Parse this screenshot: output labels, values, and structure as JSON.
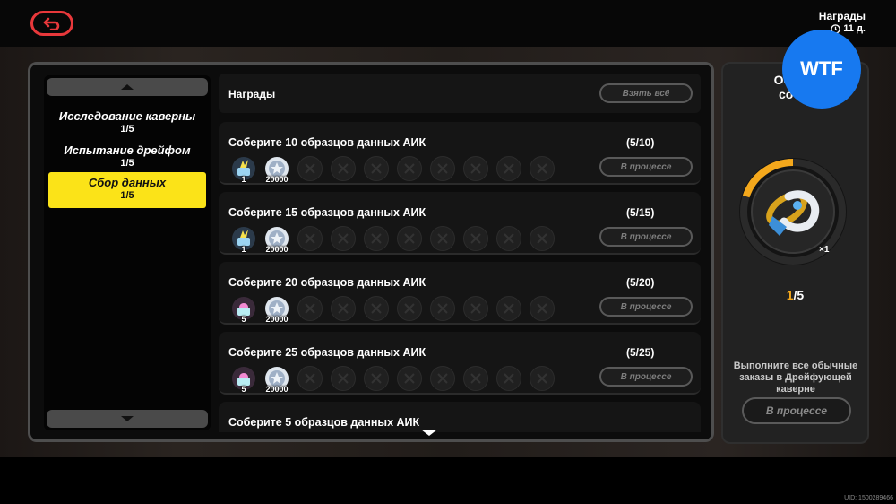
{
  "header": {
    "title": "Награды",
    "timer": "11 д."
  },
  "sidebar": {
    "items": [
      {
        "label": "Исследование каверны",
        "progress": "1/5",
        "active": false
      },
      {
        "label": "Испытание дрейфом",
        "progress": "1/5",
        "active": false
      },
      {
        "label": "Сбор данных",
        "progress": "1/5",
        "active": true
      }
    ]
  },
  "list": {
    "title": "Награды",
    "claim_all": "Взять всё",
    "quests": [
      {
        "title": "Соберите 10 образцов данных АИК",
        "progress": "(5/10)",
        "status": "В процессе",
        "rewards": [
          {
            "icon": "blue-drift-token-icon",
            "count": "1"
          },
          {
            "icon": "data-chip-icon",
            "count": "20000"
          }
        ]
      },
      {
        "title": "Соберите 15 образцов данных АИК",
        "progress": "(5/15)",
        "status": "В процессе",
        "rewards": [
          {
            "icon": "blue-drift-token-icon",
            "count": "1"
          },
          {
            "icon": "data-chip-icon",
            "count": "20000"
          }
        ]
      },
      {
        "title": "Соберите 20 образцов данных АИК",
        "progress": "(5/20)",
        "status": "В процессе",
        "rewards": [
          {
            "icon": "pink-drift-token-icon",
            "count": "5"
          },
          {
            "icon": "data-chip-icon",
            "count": "20000"
          }
        ]
      },
      {
        "title": "Соберите 25 образцов данных АИК",
        "progress": "(5/25)",
        "status": "В процессе",
        "rewards": [
          {
            "icon": "pink-drift-token-icon",
            "count": "5"
          },
          {
            "icon": "data-chip-icon",
            "count": "20000"
          }
        ]
      },
      {
        "title": "Соберите 5 образцов данных АИК",
        "progress": "",
        "status": "",
        "rewards": []
      }
    ]
  },
  "special": {
    "title_line1": "Особы",
    "title_line2": "собы",
    "reward_count": "×1",
    "progress_current": "1",
    "progress_total": "/5",
    "progress_fraction": 0.2,
    "description": "Выполните все обычные заказы в Дрейфующей каверне",
    "button": "В процессе"
  },
  "badge": "WTF",
  "uid": "UID: 1500289466",
  "colors": {
    "accent_yellow": "#fbe318",
    "accent_red": "#e8383b",
    "progress_orange": "#f4a81c",
    "badge_blue": "#1779f0"
  }
}
